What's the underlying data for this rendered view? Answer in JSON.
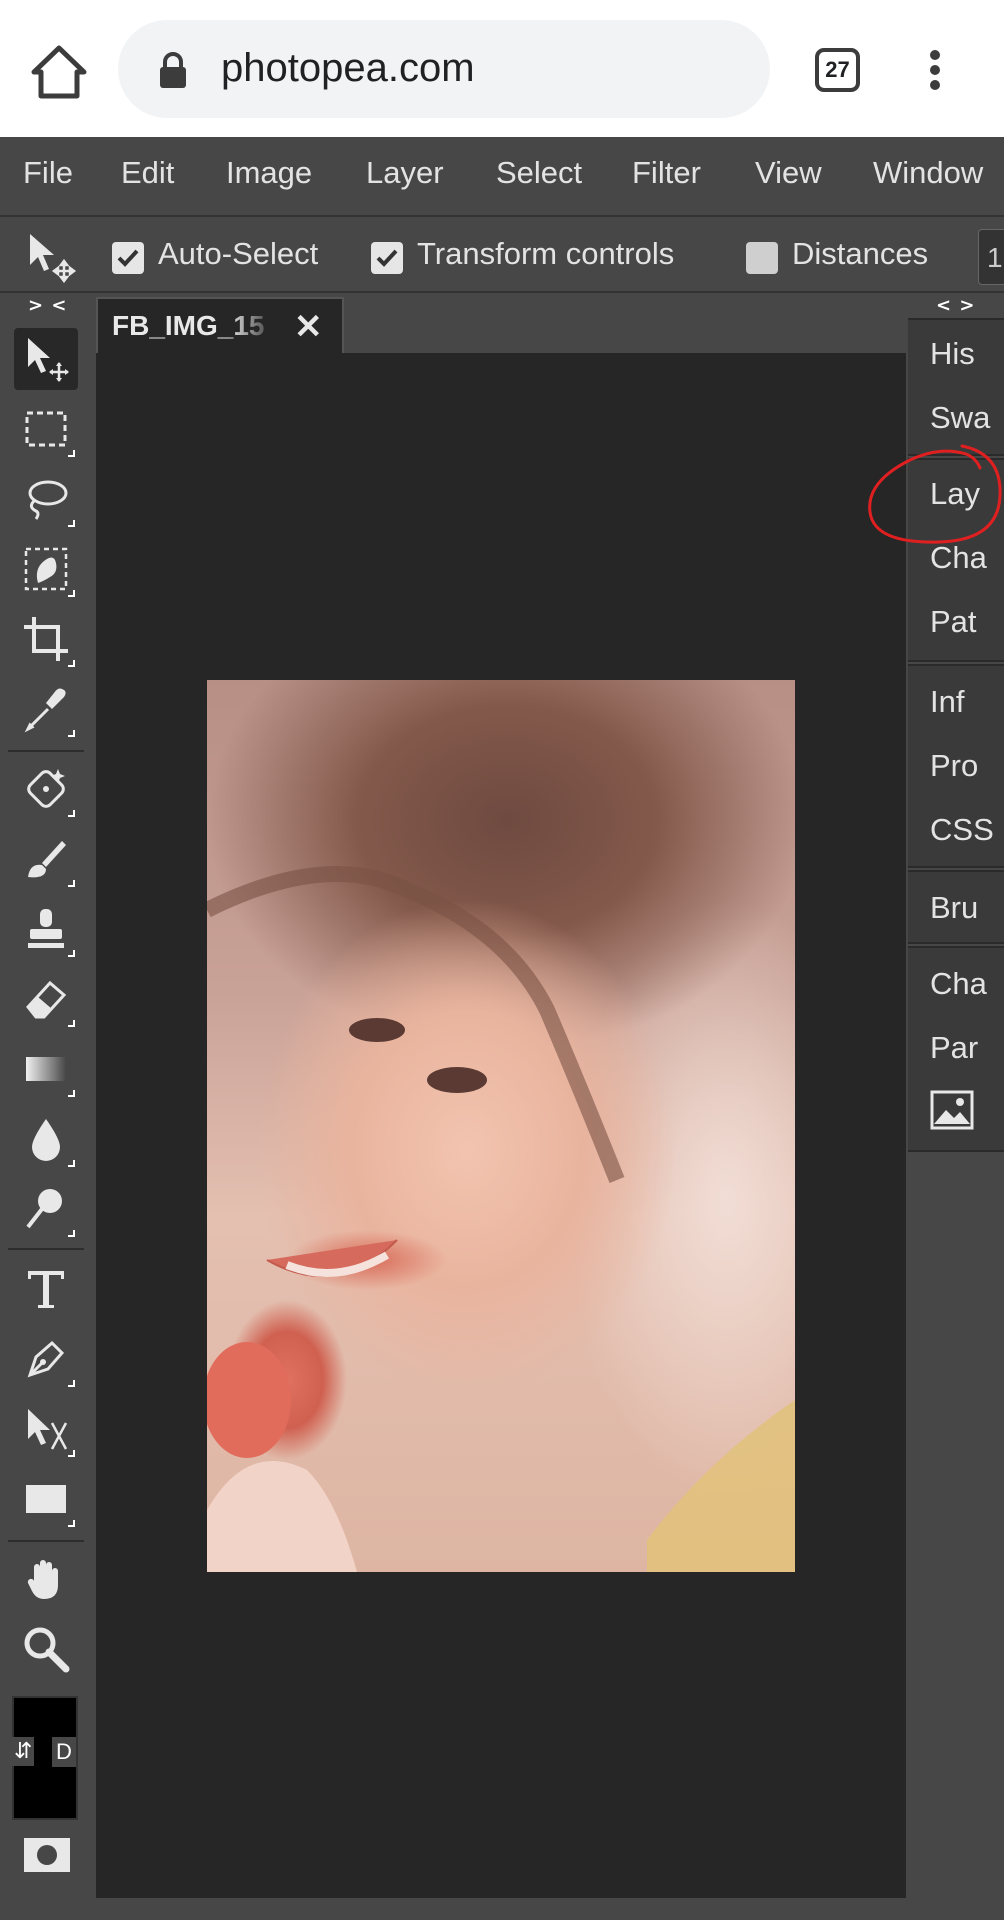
{
  "browser": {
    "url": "photopea.com",
    "tab_count": "27"
  },
  "menu": {
    "items": [
      "File",
      "Edit",
      "Image",
      "Layer",
      "Select",
      "Filter",
      "View",
      "Window"
    ]
  },
  "options_bar": {
    "auto_select_label": "Auto-Select",
    "auto_select_checked": true,
    "transform_controls_label": "Transform controls",
    "transform_controls_checked": true,
    "distances_label": "Distances",
    "distances_checked": false,
    "size_value": "1"
  },
  "toolbar": {
    "collapse_label": "> <",
    "swap_label": "⇵",
    "default_label": "D",
    "tools": [
      "move",
      "rectangular-marquee",
      "lasso",
      "quick-selection",
      "crop",
      "eyedropper",
      "spot-healing",
      "brush",
      "clone-stamp",
      "eraser",
      "gradient",
      "blur",
      "dodge",
      "type",
      "pen",
      "path-selection",
      "rectangle",
      "hand",
      "zoom"
    ],
    "active_tool": "move",
    "foreground_color": "#000000",
    "background_color": "#000000"
  },
  "document": {
    "tab_title": "FB_IMG_15",
    "close_label": "✕"
  },
  "right_panel": {
    "collapse_label": "< >",
    "group1": [
      "His",
      "Swa"
    ],
    "group2": [
      "Lay",
      "Cha",
      "Pat"
    ],
    "group3": [
      "Inf",
      "Pro",
      "CSS"
    ],
    "group4": [
      "Bru"
    ],
    "group5": [
      "Cha",
      "Par"
    ],
    "highlighted_tab": "Lay",
    "annotation_color": "#e02020"
  },
  "colors": {
    "menu_bg": "#474747",
    "workspace_bg": "#262626",
    "panel_bg": "#3a3a3a"
  }
}
